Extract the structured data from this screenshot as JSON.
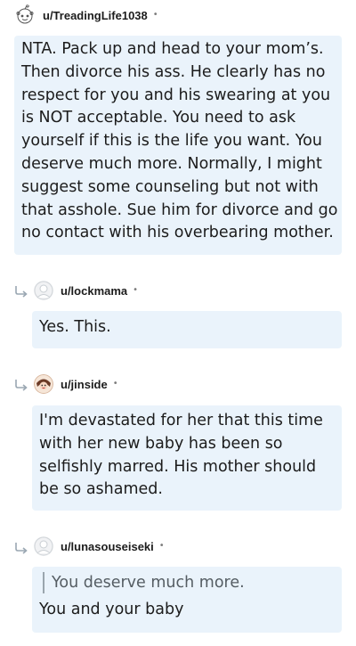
{
  "comments": [
    {
      "username": "u/TreadingLife1038",
      "body": "NTA. Pack up and head to your mom’s. Then divorce his ass. He clearly has no respect for you and his swearing at you is NOT acceptable. You need to ask yourself if this is the life you want. You deserve much more. Normally, I might suggest some counseling but not with that asshole. Sue him for divorce and go no contact with his overbearing mother.",
      "avatar_icon": "snoo-avatar-icon"
    },
    {
      "username": "u/lockmama",
      "body": "Yes. This.",
      "avatar_icon": "default-avatar-icon"
    },
    {
      "username": "u/jinside",
      "body": "I'm devastated for her that this time with her new baby has been so selfishly marred. His mother should be so ashamed.",
      "avatar_icon": "cartoon-avatar-icon"
    },
    {
      "username": "u/lunasouseiseki",
      "quote": "You deserve much more.",
      "body": "You and your baby",
      "avatar_icon": "default-avatar-icon"
    }
  ],
  "reply_icon": "reply-arrow-icon",
  "separator": "•",
  "colors": {
    "bubble_bg": "#eaf3fb",
    "text": "#1c1c1c",
    "meta": "#7c7c7c"
  }
}
